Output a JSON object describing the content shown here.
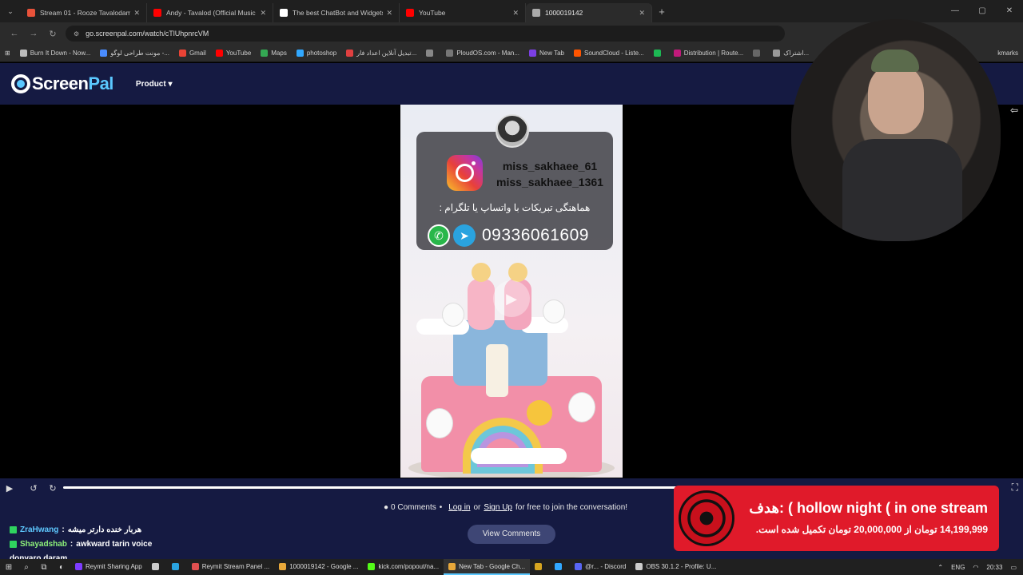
{
  "tabs": [
    {
      "title": "Stream 01 - Rooze Tavalodam I",
      "favicon_color": "#e8523a",
      "active": false
    },
    {
      "title": "Andy - Tavalod (Official Music V",
      "favicon_color": "#ff0000",
      "active": false
    },
    {
      "title": "The best ChatBot and Widgets",
      "favicon_color": "#ffffff",
      "active": false
    },
    {
      "title": "YouTube",
      "favicon_color": "#ff0000",
      "active": false
    },
    {
      "title": "1000019142",
      "favicon_color": "#aaaaaa",
      "active": true
    }
  ],
  "address_bar": {
    "url": "go.screenpal.com/watch/cTlUhpnrcVM"
  },
  "bookmarks": [
    {
      "label": "Burn It Down - Now...",
      "color": "#bbbbbb"
    },
    {
      "label": "مونت طراحی لوگو -...",
      "color": "#4a8cff"
    },
    {
      "label": "Gmail",
      "color": "#ea4335"
    },
    {
      "label": "YouTube",
      "color": "#ff0000"
    },
    {
      "label": "Maps",
      "color": "#34a853"
    },
    {
      "label": "photoshop",
      "color": "#31a8ff"
    },
    {
      "label": "تبدیل آنلاین اعداد فار...",
      "color": "#e04040"
    },
    {
      "label": "",
      "color": "#888888"
    },
    {
      "label": "PloudOS.com - Man...",
      "color": "#777777"
    },
    {
      "label": "New Tab",
      "color": "#7b3fe4"
    },
    {
      "label": "SoundCloud - Liste...",
      "color": "#ff5500"
    },
    {
      "label": "",
      "color": "#1db954"
    },
    {
      "label": "Distribution | Route...",
      "color": "#c01a7a"
    },
    {
      "label": "",
      "color": "#666666"
    },
    {
      "label": "اشتراک...",
      "color": "#999999"
    }
  ],
  "bookmarks_right": "kmarks",
  "site": {
    "logo_screen": "Screen",
    "logo_pal": "Pal",
    "product_menu": "Product ▾"
  },
  "video": {
    "handle_1": "miss_sakhaee_61",
    "handle_2": "miss_sakhaee_1361",
    "promo_text": "هماهنگی تبریکات با واتساپ یا تلگرام :",
    "phone": "09336061609"
  },
  "player": {
    "play_icon": "▶",
    "rewind_icon": "↺",
    "forward_icon": "↻",
    "fullscreen_icon": "⛶",
    "progress": 0
  },
  "comments": {
    "count_text": "0 Comments",
    "separator": "•",
    "login": "Log in",
    "or": "or",
    "signup": "Sign Up",
    "suffix": "for free to join the conversation!",
    "view_button": "View Comments"
  },
  "chat": [
    {
      "user": "ZraHwang",
      "sep": ":",
      "text": "هربار خنده دارتر میشه",
      "user_color": "blue"
    },
    {
      "user": "Shayadshab",
      "sep": ":",
      "text": "awkward tarin voice",
      "user_color": "green"
    },
    {
      "user": "",
      "sep": "",
      "text": "donyaro daram",
      "user_color": "green"
    }
  ],
  "goal": {
    "title": "هدف: ( hollow night ( in one stream",
    "subtitle": "14,199,999 تومان از 20,000,000 تومان تکمیل شده است."
  },
  "taskbar": {
    "apps": [
      {
        "label": "Reymit Sharing App",
        "color": "#7d3cff",
        "active": false
      },
      {
        "label": "",
        "color": "#cccccc",
        "active": false
      },
      {
        "label": "",
        "color": "#2aa3df",
        "active": false
      },
      {
        "label": "Reymit Stream Panel ...",
        "color": "#e05050",
        "active": false
      },
      {
        "label": "1000019142 - Google ...",
        "color": "#e8a83a",
        "active": false
      },
      {
        "label": "kick.com/popout/na...",
        "color": "#53fc18",
        "active": false
      },
      {
        "label": "New Tab - Google Ch...",
        "color": "#e8a83a",
        "active": true
      },
      {
        "label": "",
        "color": "#d6a520",
        "active": false
      },
      {
        "label": "",
        "color": "#31a8ff",
        "active": false
      },
      {
        "label": "@r... - Discord",
        "color": "#5865f2",
        "active": false
      },
      {
        "label": "OBS 30.1.2 - Profile: U...",
        "color": "#cccccc",
        "active": false
      }
    ],
    "lang": "ENG",
    "time": "20:33"
  }
}
